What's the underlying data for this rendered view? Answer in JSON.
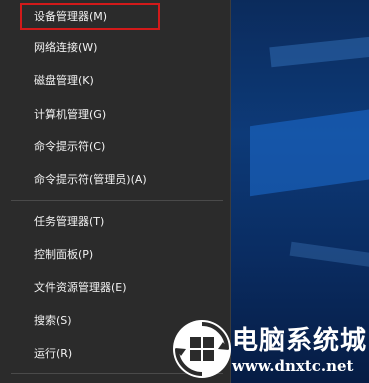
{
  "menu": {
    "items": [
      {
        "label": "设备管理器(M)"
      },
      {
        "label": "网络连接(W)"
      },
      {
        "label": "磁盘管理(K)"
      },
      {
        "label": "计算机管理(G)"
      },
      {
        "label": "命令提示符(C)"
      },
      {
        "label": "命令提示符(管理员)(A)"
      },
      {
        "label": "任务管理器(T)"
      },
      {
        "label": "控制面板(P)"
      },
      {
        "label": "文件资源管理器(E)"
      },
      {
        "label": "搜索(S)"
      },
      {
        "label": "运行(R)"
      }
    ],
    "highlighted_item": "设备管理器(M)",
    "highlight_color": "#d21a1a"
  },
  "watermark": {
    "title": "电脑系统城",
    "url": "www.dnxtc.net"
  }
}
